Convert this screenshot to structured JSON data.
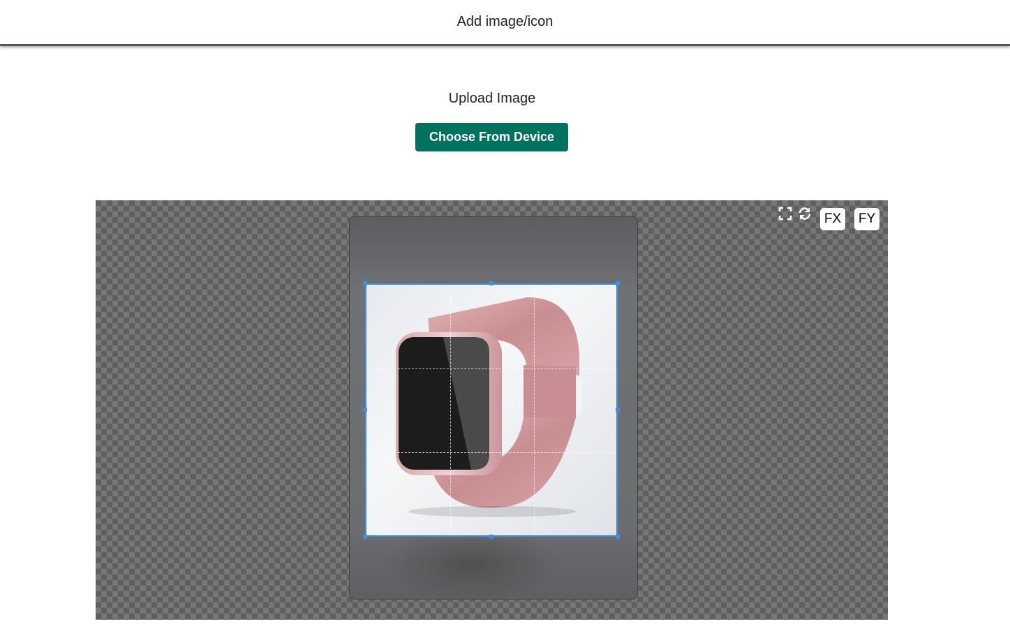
{
  "header": {
    "title": "Add image/icon"
  },
  "upload": {
    "label": "Upload Image",
    "choose_button": "Choose From Device"
  },
  "cropper": {
    "tools": {
      "fullscreen_icon": "fullscreen-icon",
      "rotate_icon": "rotate-icon",
      "flip_x_label": "FX",
      "flip_y_label": "FY"
    },
    "image_subject": "smartwatch-image"
  },
  "colors": {
    "accent_button": "#00725e",
    "crop_border": "#3c8ee6",
    "checker_dark": "#5f5f5f",
    "checker_light": "#777777"
  }
}
